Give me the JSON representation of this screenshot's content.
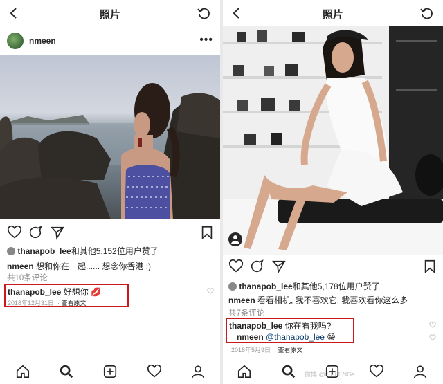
{
  "left": {
    "title": "照片",
    "username": "nmeen",
    "likes": {
      "user": "thanapob_lee",
      "rest": "和其他5,152位用户赞了"
    },
    "caption": {
      "user": "nmeen",
      "text": "想和你在一起...... 想念你香港 :)"
    },
    "comment_count": "共10条评论",
    "comment": {
      "user": "thanapob_lee",
      "text": "好想你 💋"
    },
    "date": "2018年12月31日",
    "translate": "查看原文"
  },
  "right": {
    "title": "照片",
    "likes": {
      "user": "thanapob_lee",
      "rest": "和其他5,178位用户赞了"
    },
    "caption": {
      "user": "nmeen",
      "text": "看看相机, 我不喜欢它. 我喜欢看你这么多"
    },
    "comment_count": "共7条评论",
    "comment": {
      "user": "thanapob_lee",
      "text": "你在看我吗?"
    },
    "reply": {
      "user": "nmeen",
      "mention": "@thanapob_lee",
      "emoji": "😁"
    },
    "date": "2018年5月9日",
    "translate": "查看原文"
  },
  "watermark": "微博 @iEELENGs",
  "icons": [
    "back-icon",
    "refresh-icon",
    "heart-icon",
    "comment-icon",
    "share-icon",
    "bookmark-icon",
    "home-icon",
    "search-icon",
    "add-icon",
    "activity-icon",
    "profile-icon",
    "tag-icon"
  ],
  "colors": {
    "highlight": "#c9191e",
    "mention": "#003569"
  }
}
